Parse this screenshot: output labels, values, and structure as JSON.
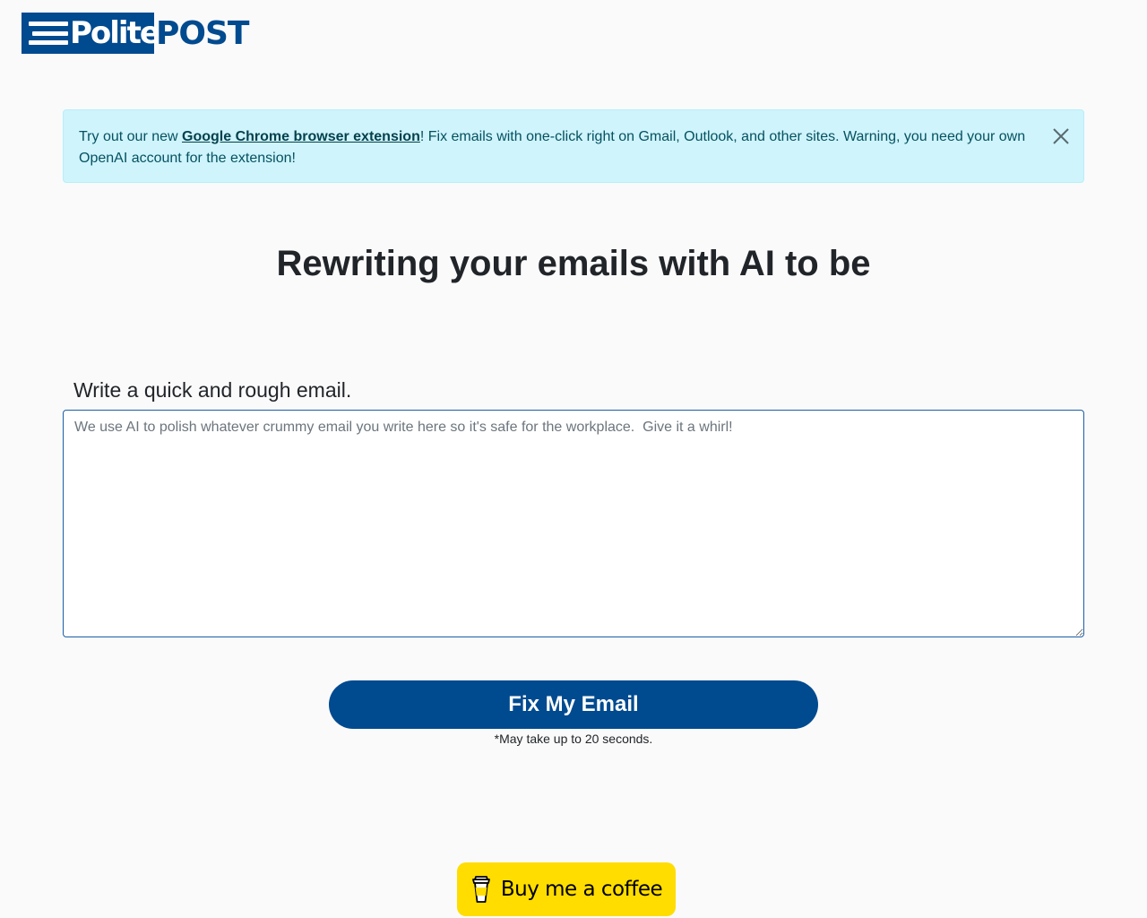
{
  "logo": {
    "part1": "Polite",
    "part2": "POST"
  },
  "alert": {
    "text_before": "Try out our new ",
    "link_text": "Google Chrome browser extension",
    "text_after": "! Fix emails with one-click right on Gmail, Outlook, and other sites. Warning, you need your own OpenAI account for the extension!",
    "close_icon": "close-icon"
  },
  "hero": {
    "title": "Rewriting your emails with AI to be"
  },
  "form": {
    "label": "Write a quick and rough email.",
    "placeholder": "We use AI to polish whatever crummy email you write here so it's safe for the workplace.  Give it a whirl!",
    "value": "",
    "submit_label": "Fix My Email",
    "note": "*May take up to 20 seconds."
  },
  "coffee": {
    "label": "Buy me a coffee",
    "icon": "coffee-cup-icon"
  },
  "colors": {
    "brand_blue": "#004a8f",
    "alert_bg": "#cff4fc",
    "alert_text": "#055160",
    "coffee_yellow": "#ffdd00",
    "page_bg": "#fafafa"
  }
}
